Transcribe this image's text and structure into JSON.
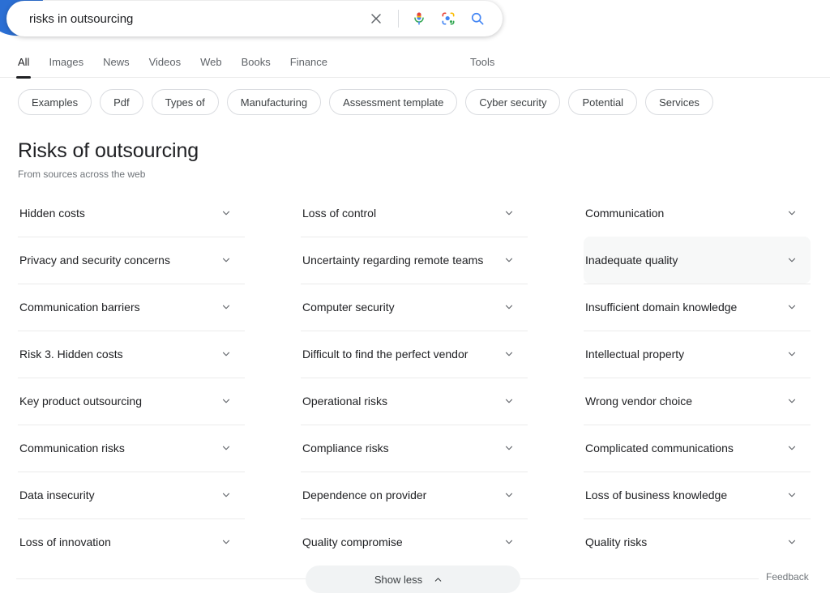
{
  "search": {
    "query": "risks in outsourcing",
    "placeholder": "Search",
    "clear_icon": "close-icon",
    "voice_icon": "microphone-icon",
    "lens_icon": "google-lens-icon",
    "submit_icon": "search-icon"
  },
  "nav": {
    "tabs": [
      {
        "label": "All",
        "active": true
      },
      {
        "label": "Images",
        "active": false
      },
      {
        "label": "News",
        "active": false
      },
      {
        "label": "Videos",
        "active": false
      },
      {
        "label": "Web",
        "active": false
      },
      {
        "label": "Books",
        "active": false
      },
      {
        "label": "Finance",
        "active": false
      }
    ],
    "tools_label": "Tools"
  },
  "chips": [
    {
      "label": "Examples"
    },
    {
      "label": "Pdf"
    },
    {
      "label": "Types of"
    },
    {
      "label": "Manufacturing"
    },
    {
      "label": "Assessment template"
    },
    {
      "label": "Cyber security"
    },
    {
      "label": "Potential"
    },
    {
      "label": "Services"
    }
  ],
  "panel": {
    "title": "Risks of outsourcing",
    "subtitle": "From sources across the web"
  },
  "columns": [
    {
      "items": [
        {
          "label": "Hidden costs",
          "highlighted": false
        },
        {
          "label": "Privacy and security concerns",
          "highlighted": false
        },
        {
          "label": "Communication barriers",
          "highlighted": false
        },
        {
          "label": "Risk 3. Hidden costs",
          "highlighted": false
        },
        {
          "label": "Key product outsourcing",
          "highlighted": false
        },
        {
          "label": "Communication risks",
          "highlighted": false
        },
        {
          "label": "Data insecurity",
          "highlighted": false
        },
        {
          "label": "Loss of innovation",
          "highlighted": false
        }
      ]
    },
    {
      "items": [
        {
          "label": "Loss of control",
          "highlighted": false
        },
        {
          "label": "Uncertainty regarding remote teams",
          "highlighted": false
        },
        {
          "label": "Computer security",
          "highlighted": false
        },
        {
          "label": "Difficult to find the perfect vendor",
          "highlighted": false
        },
        {
          "label": "Operational risks",
          "highlighted": false
        },
        {
          "label": "Compliance risks",
          "highlighted": false
        },
        {
          "label": "Dependence on provider",
          "highlighted": false
        },
        {
          "label": "Quality compromise",
          "highlighted": false
        }
      ]
    },
    {
      "items": [
        {
          "label": "Communication",
          "highlighted": false
        },
        {
          "label": "Inadequate quality",
          "highlighted": true
        },
        {
          "label": "Insufficient domain knowledge",
          "highlighted": false
        },
        {
          "label": "Intellectual property",
          "highlighted": false
        },
        {
          "label": "Wrong vendor choice",
          "highlighted": false
        },
        {
          "label": "Complicated communications",
          "highlighted": false
        },
        {
          "label": "Loss of business knowledge",
          "highlighted": false
        },
        {
          "label": "Quality risks",
          "highlighted": false
        }
      ]
    }
  ],
  "footer": {
    "show_less_label": "Show less",
    "show_less_icon": "chevron-up-icon",
    "feedback_label": "Feedback"
  },
  "colors": {
    "accent_blue": "#4285f4",
    "google_red": "#ea4335",
    "google_yellow": "#fbbc04",
    "google_green": "#34a853",
    "text_primary": "#202124",
    "text_secondary": "#5f6368",
    "highlight_bg": "#f7f8f8"
  }
}
